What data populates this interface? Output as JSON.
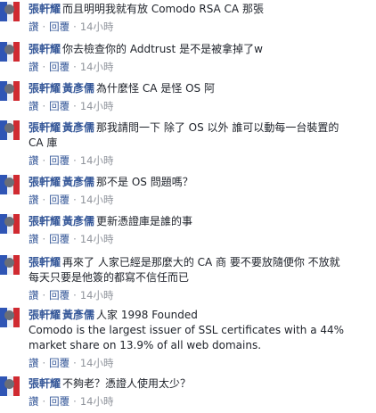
{
  "actions": {
    "like": "讚",
    "reply": "回覆",
    "separator": "·"
  },
  "comments": [
    {
      "author": "張軒耀",
      "tag": "",
      "lines": [
        "而且明明我就有放 Comodo RSA CA 那張"
      ],
      "time": "14小時"
    },
    {
      "author": "張軒耀",
      "tag": "",
      "lines": [
        "你去檢查你的 Addtrust 是不是被拿掉了w"
      ],
      "time": "14小時"
    },
    {
      "author": "張軒耀",
      "tag": "黃彥儒",
      "lines": [
        "為什麼怪 CA 是怪 OS 阿"
      ],
      "time": "14小時"
    },
    {
      "author": "張軒耀",
      "tag": "黃彥儒",
      "lines": [
        "那我請問一下 除了 OS 以外 誰可以動每一台裝置的",
        "CA 庫"
      ],
      "time": "14小時"
    },
    {
      "author": "張軒耀",
      "tag": "黃彥儒",
      "lines": [
        "那不是 OS 問題嗎？"
      ],
      "time": "14小時"
    },
    {
      "author": "張軒耀",
      "tag": "黃彥儒",
      "lines": [
        "更新憑證庫是誰的事"
      ],
      "time": "14小時"
    },
    {
      "author": "張軒耀",
      "tag": "",
      "lines": [
        "再來了 人家已經是那麼大的 CA 商 要不要放隨便你 不放就",
        "每天只要是他簽的都寫不信任而已"
      ],
      "time": "14小時"
    },
    {
      "author": "張軒耀",
      "tag": "黃彥儒",
      "lines": [
        "人家 1998 Founded",
        "Comodo is the largest issuer of SSL certificates with a 44%",
        "market share on 13.9% of all web domains."
      ],
      "time": "14小時"
    },
    {
      "author": "張軒耀",
      "tag": "",
      "lines": [
        "不夠老？憑證人使用太少？"
      ],
      "time": "14小時"
    }
  ]
}
